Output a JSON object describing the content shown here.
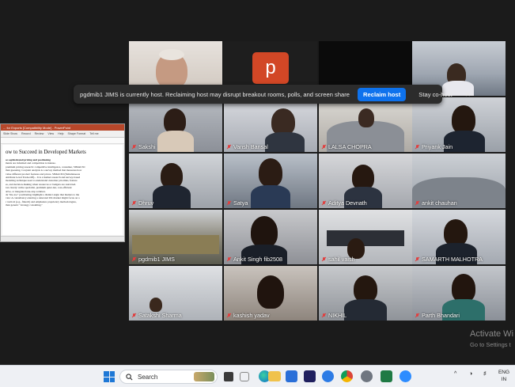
{
  "notice": {
    "message": "pgdmib1 JIMS is currently host. Reclaiming host may disrupt breakout rooms, polls, and screen share",
    "reclaim_label": "Reclaim host",
    "stay_label": "Stay co-host",
    "close_glyph": "✕"
  },
  "presenter_tile": {
    "letter": "p"
  },
  "participants": [
    {
      "name": "Sakshi"
    },
    {
      "name": "Vansh Bansal"
    },
    {
      "name": "LALSA CHOPRA"
    },
    {
      "name": "Priyank Jain"
    },
    {
      "name": "Dhruv"
    },
    {
      "name": "Satya"
    },
    {
      "name": "Aditya Devnath"
    },
    {
      "name": "ankit chauhan"
    },
    {
      "name": "pgdmib1 JIMS"
    },
    {
      "name": "Ankit Singh fib2508"
    },
    {
      "name": "sahil vaish"
    },
    {
      "name": "SAMARTH MALHOTRA"
    },
    {
      "name": "Satakshi Sharma"
    },
    {
      "name": "kashish yadav"
    },
    {
      "name": "NIKHIL"
    },
    {
      "name": "Parth Bhandari"
    }
  ],
  "ppt": {
    "window_title": "... for Exports [Compatibility Mode] - PowerPoint",
    "ribbon_tabs": [
      "Slide Show",
      "Record",
      "Review",
      "View",
      "Help",
      "Shape Format",
      "Tell me"
    ],
    "slide_heading": "ow to Succeed in Developed Markets",
    "slide_lines": [
      "se sophisticated pricing and positioning",
      "ments are informed and competition is intense.",
      "premium pricing research: competitive intelligence, consumer, SIMALTO",
      "than guessing. Conjoint analysis is a survey method that measures how",
      "value different product features and prices. SIMALTO (Simultaneous",
      "Attribute Level Trade-Off)... It is a market research and survey-based",
      "modeling technique used to understand customer priorities, feature",
      "es, and decision-making when resources or budgets are restricted.",
      "ion clearly: niche specialist, premium quiet-tier, cost-efficient",
      "ative, or integrated one-stop solution.",
      "de \"me-too\" positioning; highlight a distinct angle that matters to the",
      "vate: A consultancy entering a saturated UK market might focus on a",
      "r vertical (e.g., fintech) and emphasize proprietary methodologies,",
      "than generic \"strategy consulting.\""
    ]
  },
  "watermark": {
    "title": "Activate Wi",
    "subtitle": "Go to Settings t"
  },
  "taskbar": {
    "search_placeholder": "Search",
    "lang_line1": "ENG",
    "lang_line2": "IN"
  }
}
